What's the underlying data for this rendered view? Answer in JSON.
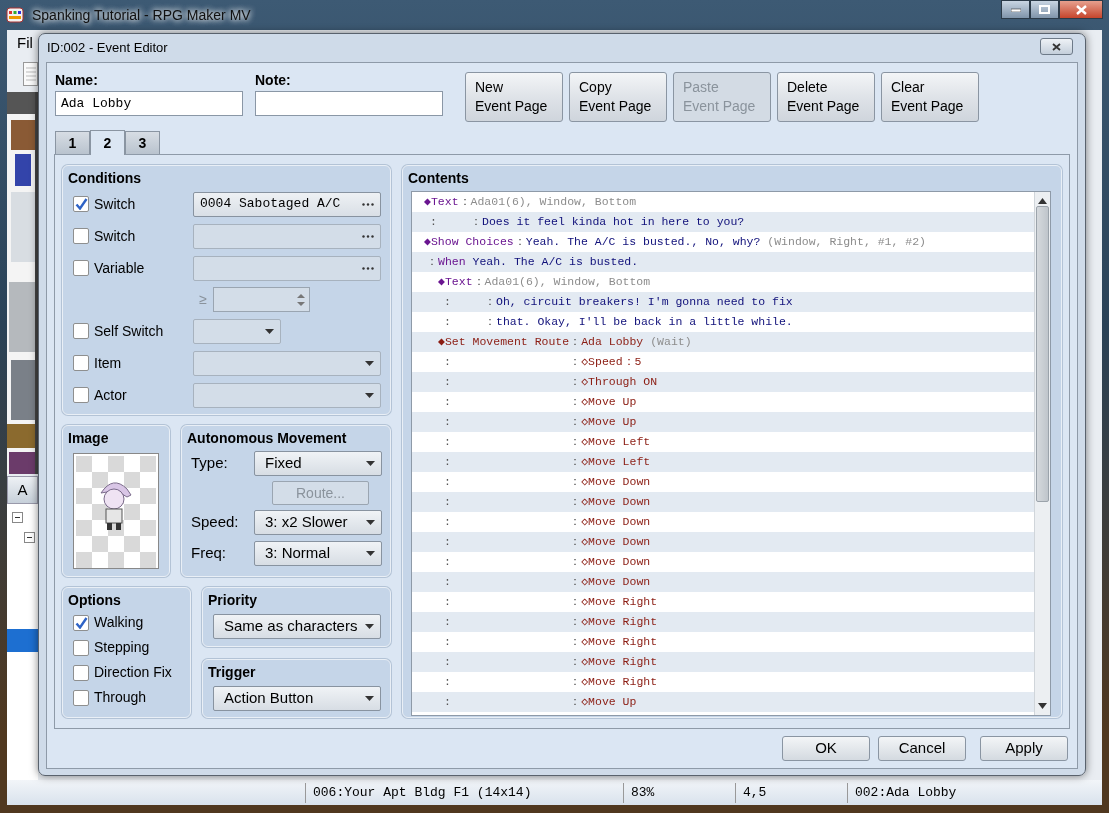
{
  "app": {
    "title": "Spanking Tutorial - RPG Maker MV",
    "menu": [
      "Fil"
    ],
    "palette_tab": "A"
  },
  "status_bar": [
    "006:Your Apt Bldg F1 (14x14)",
    "83%",
    "4,5",
    "002:Ada Lobby"
  ],
  "dialog": {
    "title": "ID:002 - Event Editor",
    "name_label": "Name:",
    "name": "Ada Lobby",
    "note_label": "Note:",
    "buttons": [
      {
        "label": "New\nEvent Page",
        "disabled": false
      },
      {
        "label": "Copy\nEvent Page",
        "disabled": false
      },
      {
        "label": "Paste\nEvent Page",
        "disabled": true
      },
      {
        "label": "Delete\nEvent Page",
        "disabled": false
      },
      {
        "label": "Clear\nEvent Page",
        "disabled": false
      }
    ],
    "tabs": [
      {
        "label": "1",
        "selected": false
      },
      {
        "label": "2",
        "selected": true
      },
      {
        "label": "3",
        "selected": false
      }
    ],
    "conditions": {
      "title": "Conditions",
      "items": [
        {
          "kind": "picker",
          "label": "Switch",
          "checked": true,
          "value": "0004 Sabotaged A/C"
        },
        {
          "kind": "picker",
          "label": "Switch",
          "checked": false
        },
        {
          "kind": "picker",
          "label": "Variable",
          "checked": false
        },
        {
          "kind": "spin",
          "label": "≥"
        },
        {
          "kind": "short-combo",
          "label": "Self Switch",
          "checked": false
        },
        {
          "kind": "combo",
          "label": "Item",
          "checked": false
        },
        {
          "kind": "combo",
          "label": "Actor",
          "checked": false
        }
      ]
    },
    "image": {
      "title": "Image"
    },
    "movement": {
      "title": "Autonomous Movement",
      "rows": [
        {
          "kind": "combo",
          "label": "Type:",
          "value": "Fixed"
        },
        {
          "kind": "button",
          "label": "Route...",
          "disabled": true
        },
        {
          "kind": "combo",
          "label": "Speed:",
          "value": "3: x2 Slower"
        },
        {
          "kind": "combo",
          "label": "Freq:",
          "value": "3: Normal"
        }
      ]
    },
    "options": {
      "title": "Options",
      "items": [
        {
          "label": "Walking",
          "checked": true
        },
        {
          "label": "Stepping",
          "checked": false
        },
        {
          "label": "Direction Fix",
          "checked": false
        },
        {
          "label": "Through",
          "checked": false
        }
      ]
    },
    "priority": {
      "title": "Priority",
      "value": "Same as characters"
    },
    "trigger": {
      "title": "Trigger",
      "value": "Action Button"
    },
    "contents": {
      "title": "Contents",
      "commands": [
        {
          "kind": "text",
          "marker": "◆",
          "command": "Text",
          "sep": "：",
          "args": "Ada01(6), Window, Bottom",
          "lines": [
            {
              "lead": ":",
              "sep": "：",
              "text": "Does it feel kinda hot in here to you?"
            }
          ]
        },
        {
          "kind": "choices",
          "marker": "◆",
          "command": "Show Choices",
          "sep": "：",
          "value": "Yeah. The A/C is busted., No, why?",
          "args": "(Window, Right, #1, #2)"
        },
        {
          "kind": "branch",
          "lead": "：",
          "command": "When",
          "value": "Yeah. The A/C is busted.",
          "children": [
            {
              "kind": "text",
              "marker": "◆",
              "command": "Text",
              "sep": "：",
              "args": "Ada01(6), Window, Bottom",
              "lines": [
                {
                  "lead": ":",
                  "sep": "：",
                  "text": "Oh, circuit breakers! I'm gonna need to fix"
                },
                {
                  "lead": ":",
                  "sep": "：",
                  "text": "that. Okay, I'll be back in a little while."
                }
              ]
            },
            {
              "kind": "route",
              "marker": "◆",
              "command": "Set Movement Route",
              "sep": "：",
              "value": "Ada Lobby",
              "args": "(Wait)",
              "steps": [
                {
                  "lead": ":",
                  "sep": "：",
                  "marker": "◇",
                  "text": "Speed：5"
                },
                {
                  "lead": ":",
                  "sep": "：",
                  "marker": "◇",
                  "text": "Through ON"
                },
                {
                  "lead": ":",
                  "sep": "：",
                  "marker": "◇",
                  "text": "Move Up"
                },
                {
                  "lead": ":",
                  "sep": "：",
                  "marker": "◇",
                  "text": "Move Up"
                },
                {
                  "lead": ":",
                  "sep": "：",
                  "marker": "◇",
                  "text": "Move Left"
                },
                {
                  "lead": ":",
                  "sep": "：",
                  "marker": "◇",
                  "text": "Move Left"
                },
                {
                  "lead": ":",
                  "sep": "：",
                  "marker": "◇",
                  "text": "Move Down"
                },
                {
                  "lead": ":",
                  "sep": "：",
                  "marker": "◇",
                  "text": "Move Down"
                },
                {
                  "lead": ":",
                  "sep": "：",
                  "marker": "◇",
                  "text": "Move Down"
                },
                {
                  "lead": ":",
                  "sep": "：",
                  "marker": "◇",
                  "text": "Move Down"
                },
                {
                  "lead": ":",
                  "sep": "：",
                  "marker": "◇",
                  "text": "Move Down"
                },
                {
                  "lead": ":",
                  "sep": "：",
                  "marker": "◇",
                  "text": "Move Down"
                },
                {
                  "lead": ":",
                  "sep": "：",
                  "marker": "◇",
                  "text": "Move Right"
                },
                {
                  "lead": ":",
                  "sep": "：",
                  "marker": "◇",
                  "text": "Move Right"
                },
                {
                  "lead": ":",
                  "sep": "：",
                  "marker": "◇",
                  "text": "Move Right"
                },
                {
                  "lead": ":",
                  "sep": "：",
                  "marker": "◇",
                  "text": "Move Right"
                },
                {
                  "lead": ":",
                  "sep": "：",
                  "marker": "◇",
                  "text": "Move Right"
                },
                {
                  "lead": ":",
                  "sep": "：",
                  "marker": "◇",
                  "text": "Move Up"
                }
              ]
            }
          ]
        }
      ]
    },
    "footer_buttons": [
      "OK",
      "Cancel",
      "Apply"
    ]
  }
}
